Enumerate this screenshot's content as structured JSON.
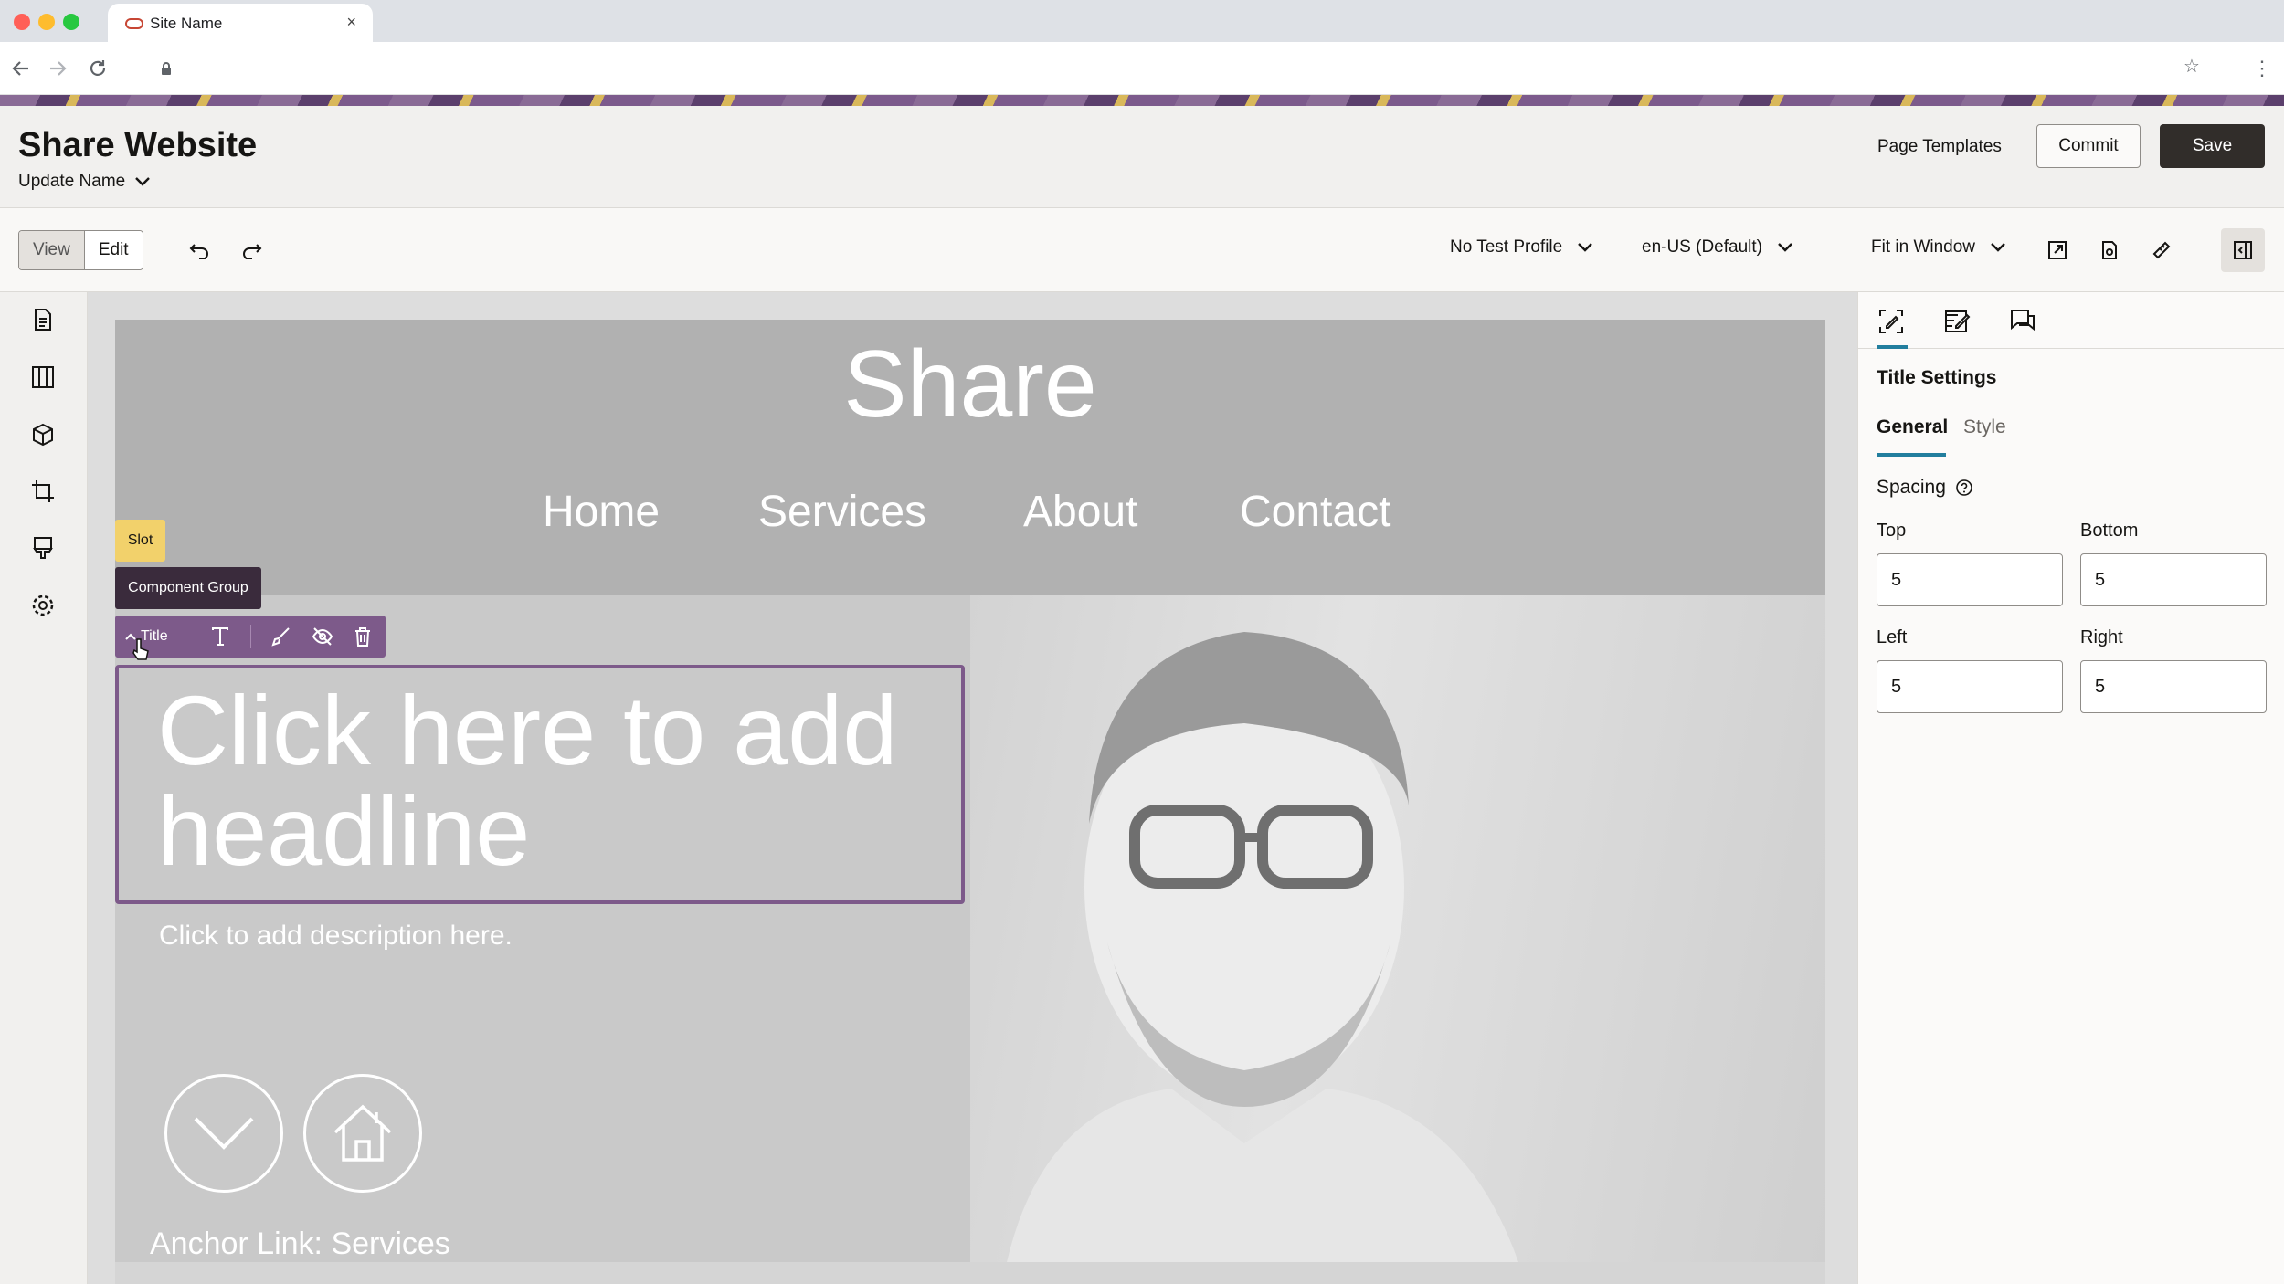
{
  "browser": {
    "tab_title": "Site Name",
    "tab_close": "×"
  },
  "header": {
    "title": "Share Website",
    "subtitle": "Update Name",
    "page_templates": "Page Templates",
    "commit": "Commit",
    "save": "Save"
  },
  "toolbar": {
    "view": "View",
    "edit": "Edit",
    "test_profile": "No Test Profile",
    "locale": "en-US (Default)",
    "zoom": "Fit in Window"
  },
  "site": {
    "brand": "Share",
    "menu": [
      "Home",
      "Services",
      "About",
      "Contact"
    ],
    "headline": "Click here to add headline",
    "description": "Click to add description here.",
    "anchor": "Anchor Link: Services"
  },
  "overlay": {
    "slot": "Slot",
    "component_group": "Component Group",
    "component": "Title"
  },
  "panel": {
    "title": "Title Settings",
    "tabs": [
      "General",
      "Style"
    ],
    "spacing_label": "Spacing",
    "fields": {
      "top_label": "Top",
      "top_value": "5",
      "bottom_label": "Bottom",
      "bottom_value": "5",
      "left_label": "Left",
      "left_value": "5",
      "right_label": "Right",
      "right_value": "5"
    }
  },
  "colors": {
    "accent": "#227e9e",
    "selection": "#7d5a8a",
    "slot": "#f2d16b",
    "save_button": "#312d2a"
  }
}
